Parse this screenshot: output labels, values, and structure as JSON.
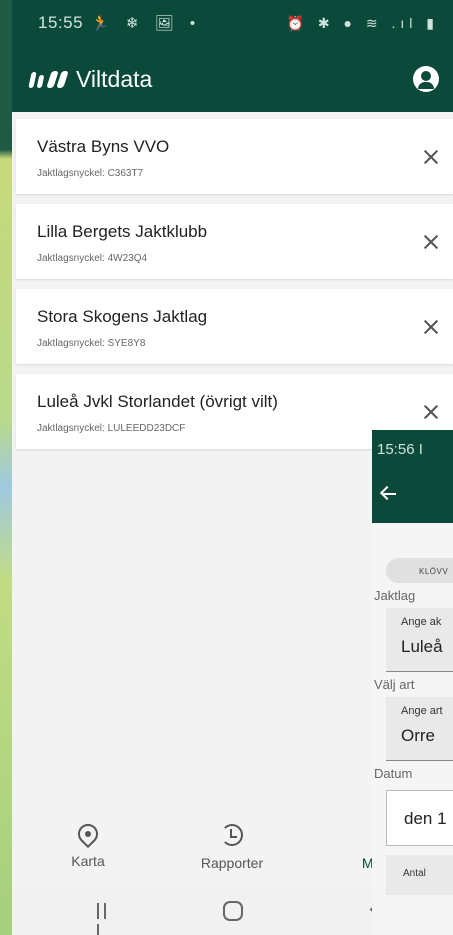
{
  "status_bar": {
    "time": "15:55",
    "left_icons": "🏃 ❄ 🖼 •",
    "right_icons": "⏰ ✱ ● ≋ .ıl ▮"
  },
  "app_bar": {
    "title": "Viltdata"
  },
  "hunting_teams": [
    {
      "name": "Västra Byns VVO",
      "key": "Jaktlagsnyckel: C363T7"
    },
    {
      "name": "Lilla Bergets Jaktklubb",
      "key": "Jaktlagsnyckel: 4W23Q4"
    },
    {
      "name": "Stora Skogens Jaktlag",
      "key": "Jaktlagsnyckel: SYE8Y8"
    },
    {
      "name": "Luleå Jvkl Storlandet (övrigt vilt)",
      "key": "Jaktlagsnyckel: LULEEDD23DCF"
    }
  ],
  "bottom_nav": {
    "karta": "Karta",
    "rapporter": "Rapporter",
    "mina": "Mina"
  },
  "overlay": {
    "time": "15:56 I",
    "chip": "KLÖVV",
    "jaktlag_label": "Jaktlag",
    "jaktlag_hint": "Ange ak",
    "jaktlag_value": "Luleå",
    "art_label": "Välj art",
    "art_hint": "Ange art",
    "art_value": "Orre",
    "datum_label": "Datum",
    "datum_value": "den 1",
    "antal_label": "Antal"
  },
  "colors": {
    "primary": "#0b4a3b",
    "background": "#f3f3f3"
  }
}
